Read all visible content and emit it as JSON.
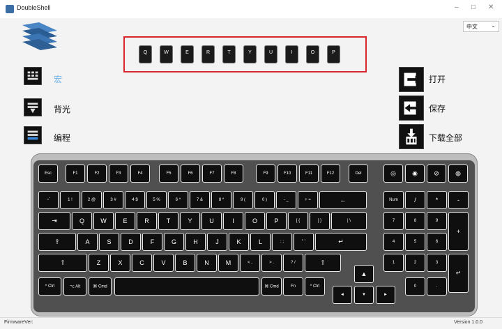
{
  "window": {
    "title": "DoubleShell",
    "minimize": "–",
    "maximize": "□",
    "close": "✕"
  },
  "language": {
    "selected": "中文"
  },
  "key_bar": [
    "Q",
    "W",
    "E",
    "R",
    "T",
    "Y",
    "U",
    "I",
    "O",
    "P"
  ],
  "left_menu": [
    {
      "label": "宏",
      "icon": "macro-keyboard-icon"
    },
    {
      "label": "背光",
      "icon": "backlight-keyboard-icon"
    },
    {
      "label": "编程",
      "icon": "program-keyboard-icon"
    }
  ],
  "right_menu": [
    {
      "label": "打开",
      "icon": "open-file-icon"
    },
    {
      "label": "保存",
      "icon": "save-file-icon"
    },
    {
      "label": "下载全部",
      "icon": "download-all-icon"
    }
  ],
  "keyboard": {
    "row_fn": [
      "Esc",
      "F1",
      "F2",
      "F3",
      "F4",
      "F5",
      "F6",
      "F7",
      "F8",
      "F9",
      "F10",
      "F11",
      "F12",
      "Del",
      "◎",
      "◉",
      "⊘",
      "◍"
    ],
    "row_num": [
      "~`",
      "1 !",
      "2 @",
      "3 #",
      "4 $",
      "5 %",
      "6 ^",
      "7 &",
      "8 *",
      "9 (",
      "0 )",
      "- _",
      "+ =",
      "←",
      "Num",
      "/",
      "*",
      "-"
    ],
    "row_q": [
      "⇥",
      "Q",
      "W",
      "E",
      "R",
      "T",
      "Y",
      "U",
      "I",
      "O",
      "P",
      "[ {",
      "] }",
      "| \\",
      "7",
      "8",
      "9",
      "+"
    ],
    "row_a": [
      "⇪",
      "A",
      "S",
      "D",
      "F",
      "G",
      "H",
      "J",
      "K",
      "L",
      ": ;",
      "\" '",
      "↵",
      "4",
      "5",
      "6"
    ],
    "row_z": [
      "⇧",
      "Z",
      "X",
      "C",
      "V",
      "B",
      "N",
      "M",
      "< ,",
      "> .",
      "? /",
      "⇧",
      "▲",
      "1",
      "2",
      "3",
      "↵"
    ],
    "row_mod": [
      "^ Ctrl",
      "⌥ Alt",
      "⌘ Cmd",
      "",
      "⌘ Cmd",
      "Fn",
      "^ Ctrl",
      "◄",
      "▼",
      "►",
      "0",
      "."
    ]
  },
  "status": {
    "firmware_label": "FirmwareVer:",
    "version": "Version 1.0.0"
  }
}
